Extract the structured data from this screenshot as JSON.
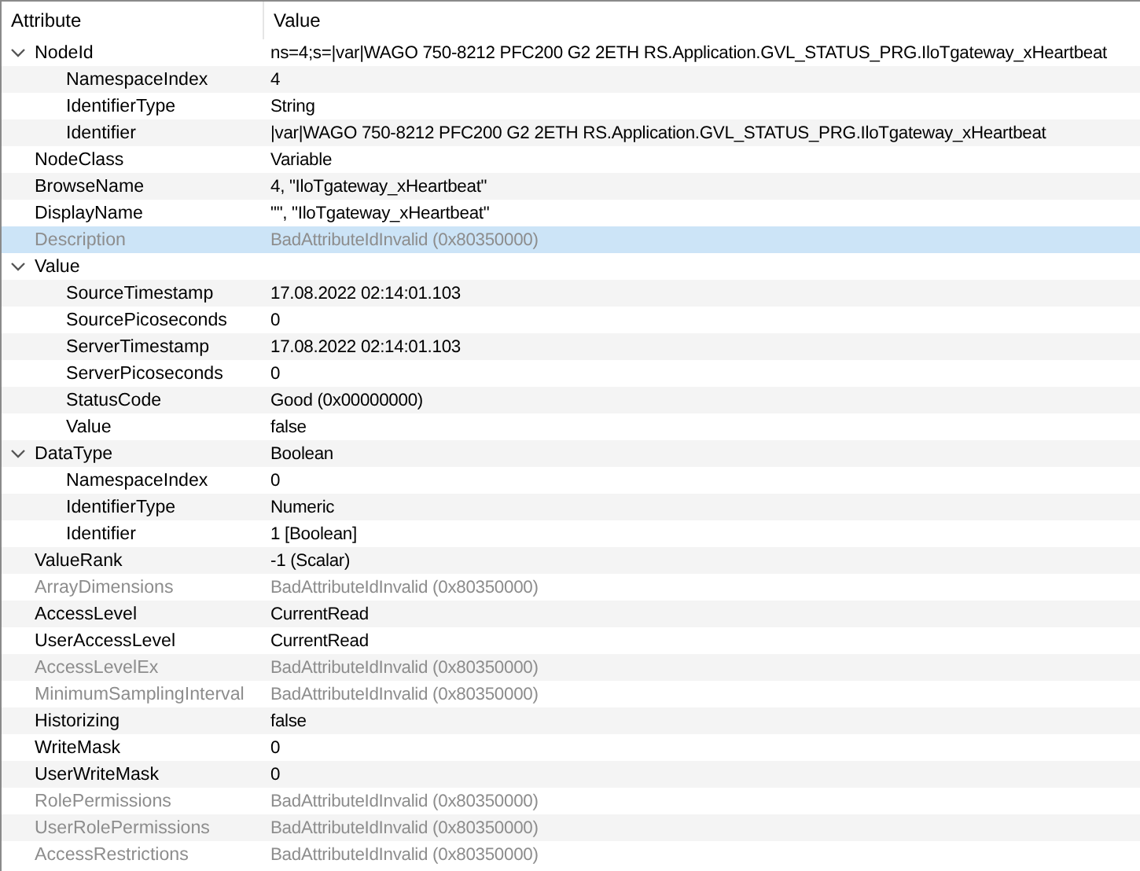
{
  "columns": [
    "Attribute",
    "Value"
  ],
  "rows": [
    {
      "attribute": "NodeId",
      "value": "ns=4;s=|var|WAGO 750-8212 PFC200 G2 2ETH RS.Application.GVL_STATUS_PRG.IloTgateway_xHeartbeat",
      "disabled": false,
      "selected": false,
      "expanded": true,
      "children": [
        {
          "attribute": "NamespaceIndex",
          "value": "4",
          "disabled": false,
          "selected": false
        },
        {
          "attribute": "IdentifierType",
          "value": "String",
          "disabled": false,
          "selected": false
        },
        {
          "attribute": "Identifier",
          "value": "|var|WAGO 750-8212 PFC200 G2 2ETH RS.Application.GVL_STATUS_PRG.IloTgateway_xHeartbeat",
          "disabled": false,
          "selected": false
        }
      ]
    },
    {
      "attribute": "NodeClass",
      "value": "Variable",
      "disabled": false,
      "selected": false
    },
    {
      "attribute": "BrowseName",
      "value": "4, \"IloTgateway_xHeartbeat\"",
      "disabled": false,
      "selected": false
    },
    {
      "attribute": "DisplayName",
      "value": "\"\", \"IloTgateway_xHeartbeat\"",
      "disabled": false,
      "selected": false
    },
    {
      "attribute": "Description",
      "value": "BadAttributeIdInvalid (0x80350000)",
      "disabled": true,
      "selected": true
    },
    {
      "attribute": "Value",
      "disabled": false,
      "selected": false,
      "expanded": true,
      "children": [
        {
          "attribute": "SourceTimestamp",
          "value": "17.08.2022 02:14:01.103",
          "disabled": false,
          "selected": false
        },
        {
          "attribute": "SourcePicoseconds",
          "value": "0",
          "disabled": false,
          "selected": false
        },
        {
          "attribute": "ServerTimestamp",
          "value": "17.08.2022 02:14:01.103",
          "disabled": false,
          "selected": false
        },
        {
          "attribute": "ServerPicoseconds",
          "value": "0",
          "disabled": false,
          "selected": false
        },
        {
          "attribute": "StatusCode",
          "value": "Good (0x00000000)",
          "disabled": false,
          "selected": false
        },
        {
          "attribute": "Value",
          "value": "false",
          "disabled": false,
          "selected": false
        }
      ]
    },
    {
      "attribute": "DataType",
      "value": "Boolean",
      "disabled": false,
      "selected": false,
      "expanded": true,
      "children": [
        {
          "attribute": "NamespaceIndex",
          "value": "0",
          "disabled": false,
          "selected": false
        },
        {
          "attribute": "IdentifierType",
          "value": "Numeric",
          "disabled": false,
          "selected": false
        },
        {
          "attribute": "Identifier",
          "value": "1 [Boolean]",
          "disabled": false,
          "selected": false
        }
      ]
    },
    {
      "attribute": "ValueRank",
      "value": "-1 (Scalar)",
      "disabled": false,
      "selected": false
    },
    {
      "attribute": "ArrayDimensions",
      "value": "BadAttributeIdInvalid (0x80350000)",
      "disabled": true,
      "selected": false
    },
    {
      "attribute": "AccessLevel",
      "value": "CurrentRead",
      "disabled": false,
      "selected": false
    },
    {
      "attribute": "UserAccessLevel",
      "value": "CurrentRead",
      "disabled": false,
      "selected": false
    },
    {
      "attribute": "AccessLevelEx",
      "value": "BadAttributeIdInvalid (0x80350000)",
      "disabled": true,
      "selected": false
    },
    {
      "attribute": "MinimumSamplingInterval",
      "value": "BadAttributeIdInvalid (0x80350000)",
      "disabled": true,
      "selected": false
    },
    {
      "attribute": "Historizing",
      "value": "false",
      "disabled": false,
      "selected": false
    },
    {
      "attribute": "WriteMask",
      "value": "0",
      "disabled": false,
      "selected": false
    },
    {
      "attribute": "UserWriteMask",
      "value": "0",
      "disabled": false,
      "selected": false
    },
    {
      "attribute": "RolePermissions",
      "value": "BadAttributeIdInvalid (0x80350000)",
      "disabled": true,
      "selected": false
    },
    {
      "attribute": "UserRolePermissions",
      "value": "BadAttributeIdInvalid (0x80350000)",
      "disabled": true,
      "selected": false
    },
    {
      "attribute": "AccessRestrictions",
      "value": "BadAttributeIdInvalid (0x80350000)",
      "disabled": true,
      "selected": false
    }
  ]
}
